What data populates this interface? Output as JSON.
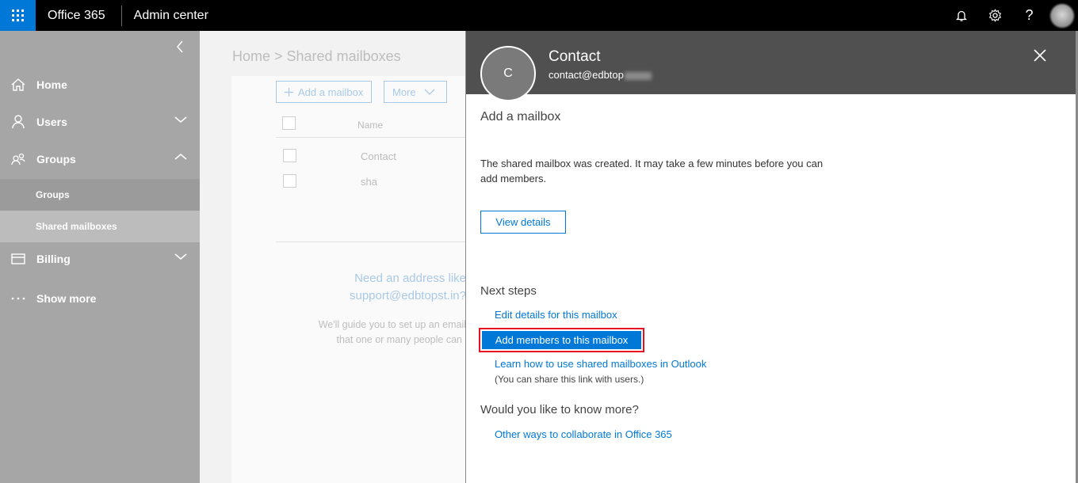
{
  "topbar": {
    "brand": "Office 365",
    "app_name": "Admin center",
    "icons": [
      "app-launcher-icon",
      "bell-icon",
      "gear-icon",
      "help-icon",
      "user-avatar"
    ],
    "help_glyph": "?",
    "brand_color": "#0078d7"
  },
  "sidebar": {
    "items": [
      {
        "label": "Home",
        "icon": "home-icon"
      },
      {
        "label": "Users",
        "icon": "user-icon"
      },
      {
        "label": "Groups",
        "icon": "groups-icon"
      },
      {
        "label": "Groups",
        "icon": ""
      },
      {
        "label": "Shared mailboxes",
        "icon": ""
      },
      {
        "label": "Billing",
        "icon": "billing-icon"
      },
      {
        "label": "Show more",
        "icon": "ellipsis-icon"
      }
    ]
  },
  "main": {
    "breadcrumb": "Home > Shared mailboxes",
    "add_mailbox_label": "Add a mailbox",
    "more_label": "More",
    "column_name": "Name",
    "rows": [
      "Contact",
      "sha"
    ],
    "empty_title_line1": "Need an address like",
    "empty_title_line2": "support@edbtopst.in?",
    "empty_desc_line1": "We'll guide you to set up an email",
    "empty_desc_line2": "that one or many people can"
  },
  "panel": {
    "avatar_initial": "C",
    "title": "Contact",
    "email": "contact@edbtop",
    "section_title": "Add a mailbox",
    "message": "The shared mailbox was created. It may take a few minutes before you can add members.",
    "view_details_label": "View details",
    "next_steps_title": "Next steps",
    "edit_details_link": "Edit details for this mailbox",
    "add_members_label": "Add members to this mailbox",
    "learn_link": "Learn how to use shared mailboxes in Outlook",
    "learn_note": "(You can share this link with users.)",
    "know_more_title": "Would you like to know more?",
    "collaborate_link": "Other ways to collaborate in Office 365",
    "highlight_color": "#e81123"
  }
}
